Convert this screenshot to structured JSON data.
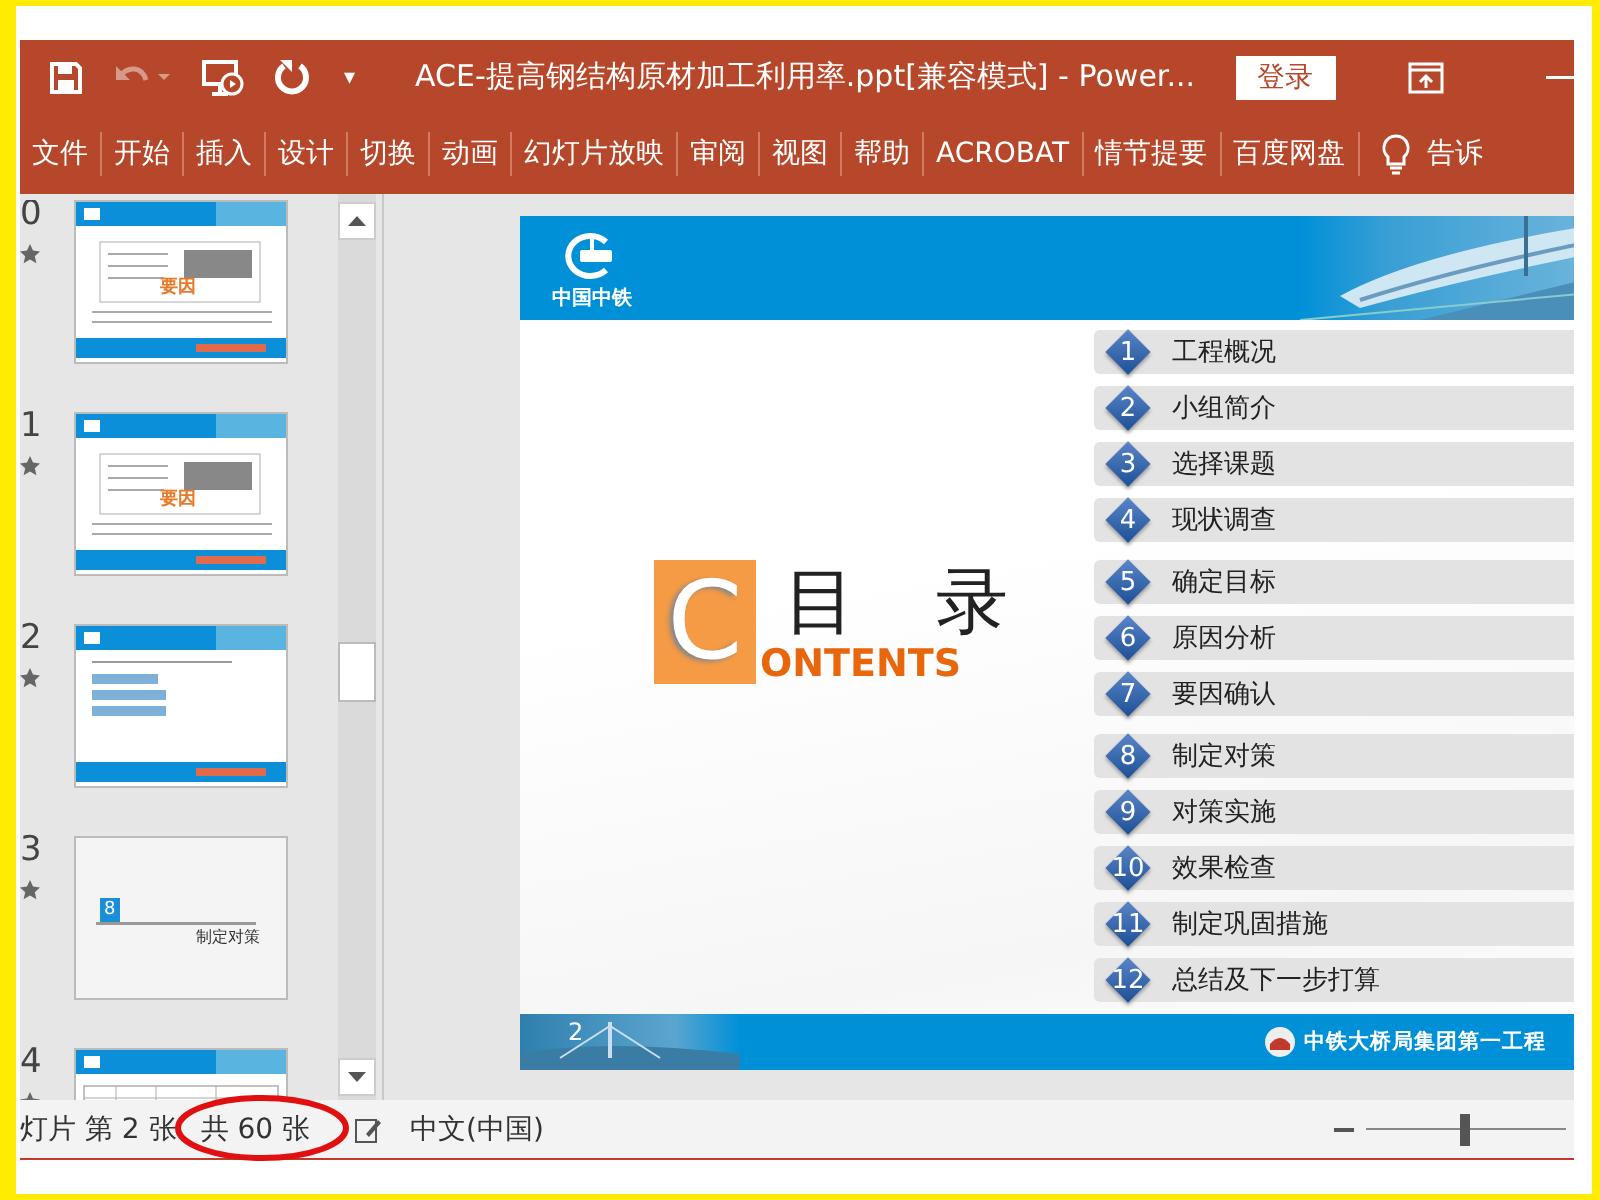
{
  "title_bar": {
    "title": "ACE-提高钢结构原材加工利用率.ppt[兼容模式]  -  Power...",
    "undo_disabled": true,
    "login_button": "登录",
    "dropdown": "▾"
  },
  "ribbon_tabs": [
    "文件",
    "开始",
    "插入",
    "设计",
    "切换",
    "动画",
    "幻灯片放映",
    "审阅",
    "视图",
    "帮助",
    "ACROBAT",
    "情节提要",
    "百度网盘"
  ],
  "tell_me": "告诉",
  "thumbnails": [
    {
      "number": "0",
      "kind": "cause",
      "label": "要因"
    },
    {
      "number": "1",
      "kind": "cause",
      "label": "要因"
    },
    {
      "number": "2",
      "kind": "list"
    },
    {
      "number": "3",
      "kind": "section",
      "badge": "8",
      "label": "制定对策"
    },
    {
      "number": "4",
      "kind": "table"
    }
  ],
  "slide": {
    "logo_text": "中国中铁",
    "title_letter": "C",
    "title_words": [
      "目",
      "录"
    ],
    "title_rest": "ONTENTS",
    "page_number": "2",
    "footer_text": "中铁大桥局集团第一工程",
    "toc": [
      {
        "number": "1",
        "label": "工程概况"
      },
      {
        "number": "2",
        "label": "小组简介"
      },
      {
        "number": "3",
        "label": "选择课题"
      },
      {
        "number": "4",
        "label": "现状调查"
      },
      {
        "number": "5",
        "label": "确定目标"
      },
      {
        "number": "6",
        "label": "原因分析"
      },
      {
        "number": "7",
        "label": "要因确认"
      },
      {
        "number": "8",
        "label": "制定对策"
      },
      {
        "number": "9",
        "label": "对策实施"
      },
      {
        "number": "10",
        "label": "效果检查"
      },
      {
        "number": "11",
        "label": "制定巩固措施"
      },
      {
        "number": "12",
        "label": "总结及下一步打算"
      }
    ]
  },
  "status_bar": {
    "slide_position": "灯片 第 2 张",
    "slide_count": "共 60 张",
    "count_circled": true,
    "language": "中文(中国)",
    "zoom": {
      "level": 0.5
    }
  }
}
